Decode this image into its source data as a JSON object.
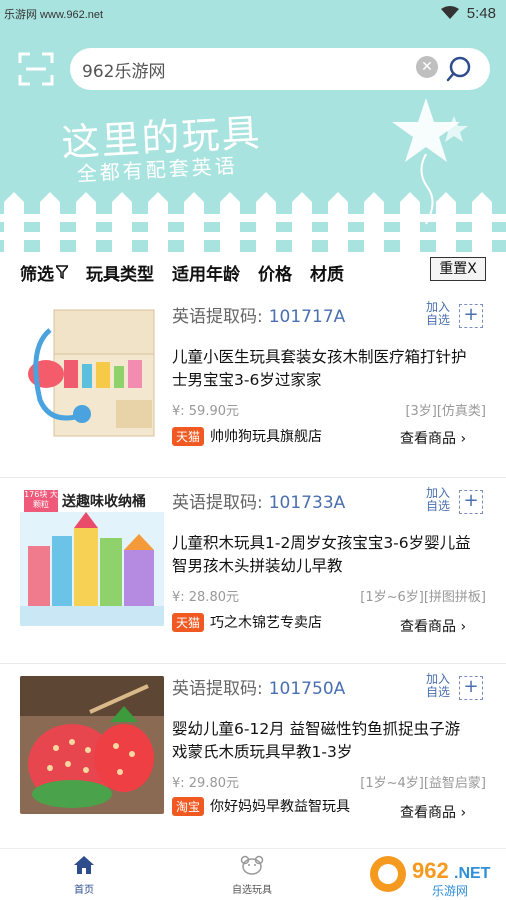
{
  "status_bar": {
    "watermark": "乐游网 www.962.net",
    "time": "5:48"
  },
  "search": {
    "value": "962乐游网",
    "placeholder": ""
  },
  "banner": {
    "title": "这里的玩具",
    "subtitle": "全都有配套英语"
  },
  "filters": {
    "items": [
      "筛选",
      "玩具类型",
      "适用年龄",
      "价格",
      "材质"
    ],
    "reset_label": "重置X"
  },
  "products": [
    {
      "code_label": "英语提取码:",
      "code": "101717A",
      "add_label": "加入自选",
      "add_button": "+",
      "title": "儿童小医生玩具套装女孩木制医疗箱打针护士男宝宝3-6岁过家家",
      "price": "¥: 59.90元",
      "tags": "[3岁][仿真类]",
      "platform": "天猫",
      "store": "帅帅狗玩具旗舰店",
      "view": "查看商品",
      "view_arrow": "›"
    },
    {
      "code_label": "英语提取码:",
      "code": "101733A",
      "add_label": "加入自选",
      "add_button": "+",
      "title": "儿童积木玩具1-2周岁女孩宝宝3-6岁婴儿益智男孩木头拼装幼儿早教",
      "price": "¥: 28.80元",
      "tags": "[1岁~6岁][拼图拼板]",
      "platform": "天猫",
      "store": "巧之木锦艺专卖店",
      "view": "查看商品",
      "view_arrow": "›",
      "image_banner": "送趣味收纳桶",
      "image_badge": "176块 大颗粒"
    },
    {
      "code_label": "英语提取码:",
      "code": "101750A",
      "add_label": "加入自选",
      "add_button": "+",
      "title": "婴幼儿童6-12月 益智磁性钓鱼抓捉虫子游戏蒙氏木质玩具早教1-3岁",
      "price": "¥: 29.80元",
      "tags": "[1岁~4岁][益智启蒙]",
      "platform": "淘宝",
      "store": "你好妈妈早教益智玩具",
      "view": "查看商品",
      "view_arrow": "›"
    }
  ],
  "tabbar": {
    "home": "首页",
    "favorites": "自选玩具"
  },
  "watermark": {
    "brand": "962",
    "suffix": ".NET",
    "sub": "乐游网"
  },
  "colors": {
    "header_bg": "#a9e3df",
    "accent_blue": "#4a6fb0",
    "platform_tag": "#f05a22"
  }
}
